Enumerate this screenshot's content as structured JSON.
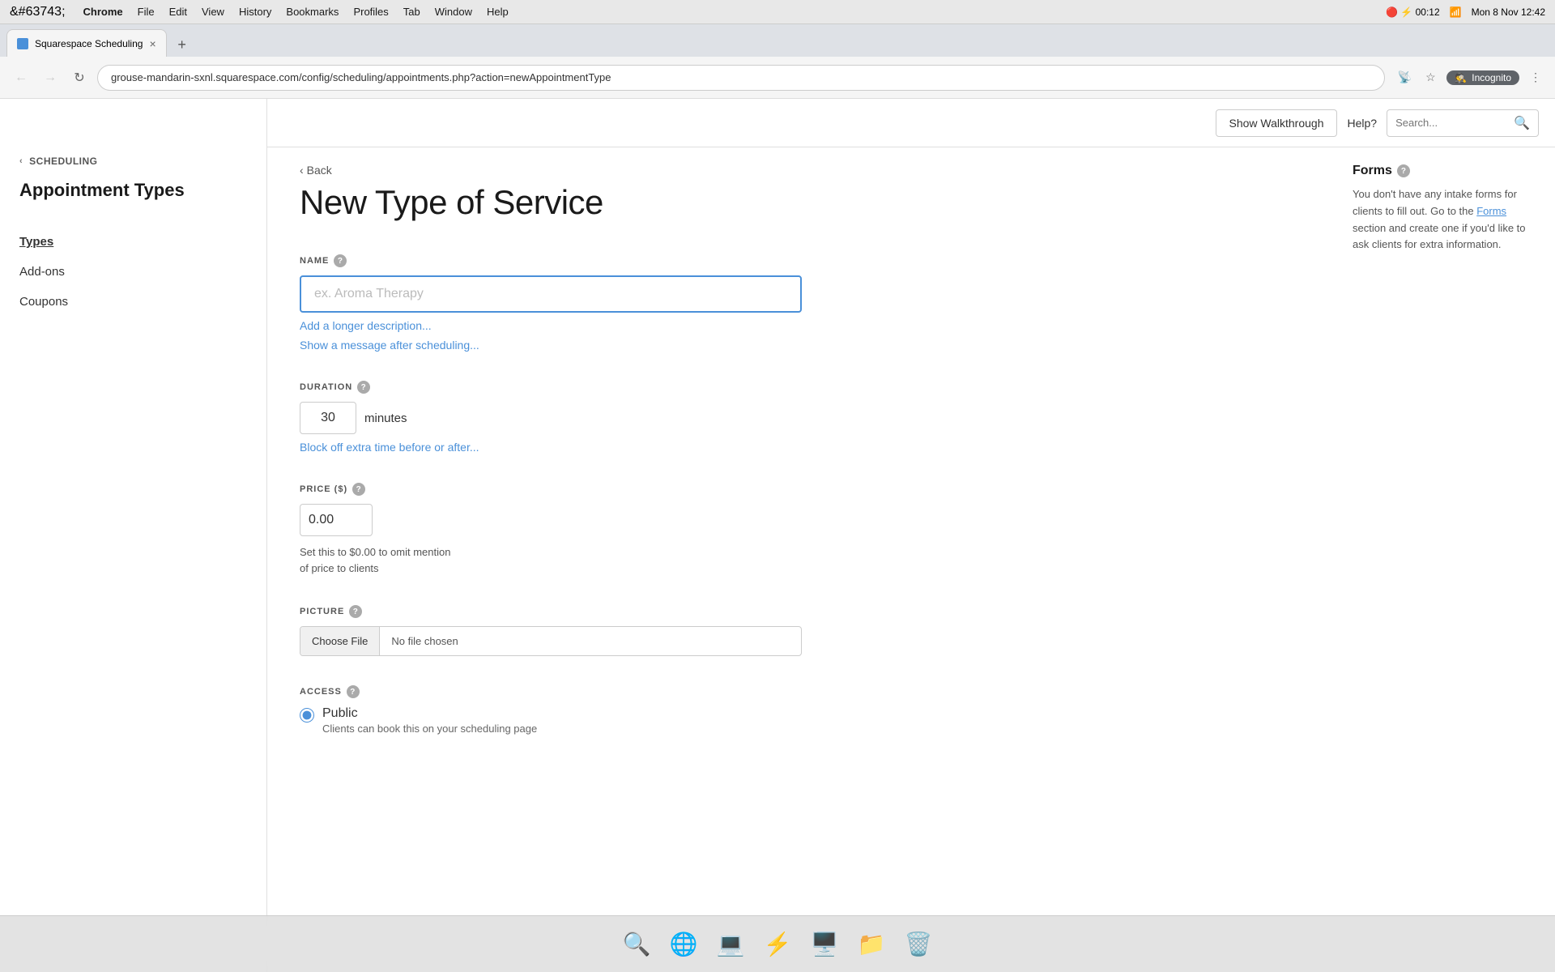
{
  "os": {
    "menubar": {
      "apple": "&#63743;",
      "chrome": "Chrome",
      "items": [
        "File",
        "Edit",
        "View",
        "History",
        "Bookmarks",
        "Profiles",
        "Tab",
        "Window",
        "Help"
      ],
      "time": "Mon 8 Nov  12:42",
      "battery_icon": "🔋",
      "battery_time": "00:12"
    }
  },
  "browser": {
    "tab_title": "Squarespace Scheduling",
    "tab_close": "×",
    "url": "grouse-mandarin-sxnl.squarespace.com/config/scheduling/appointments.php?action=newAppointmentType",
    "incognito_label": "Incognito"
  },
  "header": {
    "walkthrough_label": "Show Walkthrough",
    "help_label": "Help?",
    "search_placeholder": "Search..."
  },
  "sidebar": {
    "scheduling_label": "SCHEDULING",
    "section_title": "Appointment Types",
    "nav_items": [
      {
        "label": "Types",
        "active": true
      },
      {
        "label": "Add-ons",
        "active": false
      },
      {
        "label": "Coupons",
        "active": false
      }
    ]
  },
  "form": {
    "back_label": "Back",
    "page_title": "New Type of Service",
    "name_label": "NAME",
    "name_placeholder": "ex. Aroma Therapy",
    "name_value": "",
    "add_description_label": "Add a longer description...",
    "show_message_label": "Show a message after scheduling...",
    "duration_label": "DURATION",
    "duration_value": "30",
    "duration_unit": "minutes",
    "block_extra_label": "Block off extra time before or after...",
    "price_label": "PRICE ($)",
    "price_value": "0.00",
    "price_note_line1": "Set this to $0.00 to omit mention",
    "price_note_line2": "of price to clients",
    "picture_label": "PICTURE",
    "choose_file_label": "Choose File",
    "no_file_label": "No file chosen",
    "access_label": "ACCESS",
    "access_option_label": "Public",
    "access_option_sub": "Clients can book this on your scheduling page"
  },
  "right_panel": {
    "forms_title": "Forms",
    "forms_text_1": "You don't have any intake forms for clients to fill out.",
    "forms_link": "Forms",
    "forms_text_2": " section and create one if you'd like to ask clients for extra information.",
    "forms_prefix": "Go to the "
  },
  "dock": {
    "items": [
      "🔍",
      "🌐",
      "💻",
      "⚡",
      "🖥️",
      "📁",
      "🗑️"
    ]
  }
}
